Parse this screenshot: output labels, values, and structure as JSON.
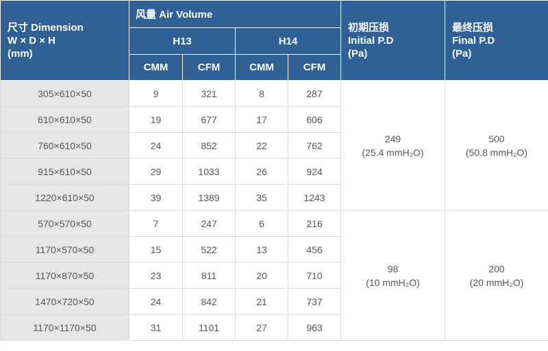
{
  "header": {
    "dimension": {
      "line1": "尺寸  Dimension",
      "line2": "W × D × H",
      "line3": "(mm)"
    },
    "air_volume": "风量 Air Volume",
    "grades": [
      "H13",
      "H14"
    ],
    "units": [
      "CMM",
      "CFM",
      "CMM",
      "CFM"
    ],
    "initial_pd": {
      "line1": "初期压损",
      "line2": "Initial P.D",
      "line3": "(Pa)"
    },
    "final_pd": {
      "line1": "最终压损",
      "line2": "Final P.D",
      "line3": "(Pa)"
    }
  },
  "rows": [
    {
      "dim": "305×610×50",
      "h13_cmm": "9",
      "h13_cfm": "321",
      "h14_cmm": "8",
      "h14_cfm": "287"
    },
    {
      "dim": "610×610×50",
      "h13_cmm": "19",
      "h13_cfm": "677",
      "h14_cmm": "17",
      "h14_cfm": "606"
    },
    {
      "dim": "760×610×50",
      "h13_cmm": "24",
      "h13_cfm": "852",
      "h14_cmm": "22",
      "h14_cfm": "762"
    },
    {
      "dim": "915×610×50",
      "h13_cmm": "29",
      "h13_cfm": "1033",
      "h14_cmm": "26",
      "h14_cfm": "924"
    },
    {
      "dim": "1220×610×50",
      "h13_cmm": "39",
      "h13_cfm": "1389",
      "h14_cmm": "35",
      "h14_cfm": "1243"
    },
    {
      "dim": "570×570×50",
      "h13_cmm": "7",
      "h13_cfm": "247",
      "h14_cmm": "6",
      "h14_cfm": "216"
    },
    {
      "dim": "1170×570×50",
      "h13_cmm": "15",
      "h13_cfm": "522",
      "h14_cmm": "13",
      "h14_cfm": "456"
    },
    {
      "dim": "1170×870×50",
      "h13_cmm": "23",
      "h13_cfm": "811",
      "h14_cmm": "20",
      "h14_cfm": "710"
    },
    {
      "dim": "1470×720×50",
      "h13_cmm": "24",
      "h13_cfm": "842",
      "h14_cmm": "21",
      "h14_cfm": "737"
    },
    {
      "dim": "1170×1170×50",
      "h13_cmm": "31",
      "h13_cfm": "1101",
      "h14_cmm": "27",
      "h14_cfm": "963"
    }
  ],
  "groups": [
    {
      "initial": {
        "pa": "249",
        "mmh2o": "(25.4 mmH₂O)"
      },
      "final": {
        "pa": "500",
        "mmh2o": "(50.8 mmH₂O)"
      }
    },
    {
      "initial": {
        "pa": "98",
        "mmh2o": "(10 mmH₂O)"
      },
      "final": {
        "pa": "200",
        "mmh2o": "(20 mmH₂O)"
      }
    }
  ],
  "colors": {
    "header_bg": "#2f6196",
    "header_text": "#ffffff",
    "dimension_col_bg": "#e6e6e6",
    "body_text": "#555555"
  }
}
